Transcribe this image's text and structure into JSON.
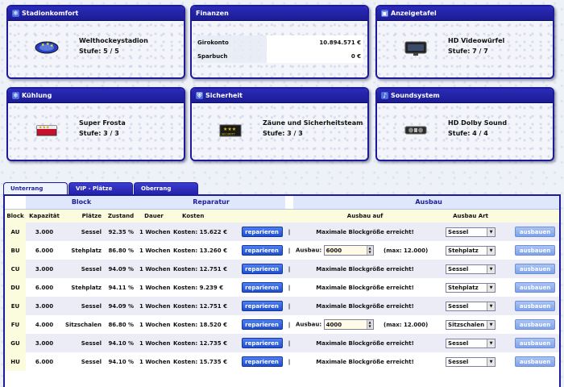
{
  "panels": {
    "stadionkomfort": {
      "title": "Stadionkomfort",
      "name": "Welthockeystadion",
      "level": "Stufe: 5 / 5"
    },
    "finanzen": {
      "title": "Finanzen",
      "rows": [
        {
          "label": "Girokonto",
          "value": "10.894.571 €"
        },
        {
          "label": "Sparbuch",
          "value": "0 €"
        }
      ]
    },
    "anzeigetafel": {
      "title": "Anzeigetafel",
      "name": "HD Videowürfel",
      "level": "Stufe: 7 / 7"
    },
    "kuehlung": {
      "title": "Kühlung",
      "name": "Super Frosta",
      "level": "Stufe: 3 / 3"
    },
    "sicherheit": {
      "title": "Sicherheit",
      "name": "Zäune und Sicherheitsteam",
      "level": "Stufe: 3 / 3",
      "badge": "SECURITY"
    },
    "soundsystem": {
      "title": "Soundsystem",
      "name": "HD Dolby Sound",
      "level": "Stufe: 4 / 4"
    }
  },
  "tabs": [
    {
      "label": "Unterrang",
      "active": true
    },
    {
      "label": "VIP - Plätze",
      "active": false
    },
    {
      "label": "Oberrang",
      "active": false
    }
  ],
  "table": {
    "groups": {
      "block": "Block",
      "reparatur": "Reparatur",
      "ausbau": "Ausbau"
    },
    "columns": {
      "block": "Block",
      "kapazitaet": "Kapazität",
      "plaetze": "Plätze",
      "zustand": "Zustand",
      "dauer": "Dauer",
      "kosten": "Kosten",
      "ausbau_auf": "Ausbau auf",
      "ausbau_art": "Ausbau Art"
    },
    "repair_label": "reparieren",
    "build_label": "ausbauen",
    "separator": "|",
    "rows": [
      {
        "block": "AU",
        "kapazitaet": "3.000",
        "plaetze": "Sessel",
        "zustand": "92.35 %",
        "dauer": "1 Wochen",
        "kosten": "Kosten: 15.622 €",
        "ausbau_text": "Maximale Blockgröße erreicht!",
        "art": "Sessel"
      },
      {
        "block": "BU",
        "kapazitaet": "6.000",
        "plaetze": "Stehplatz",
        "zustand": "86.80 %",
        "dauer": "1 Wochen",
        "kosten": "Kosten: 13.260 €",
        "ausbau_label": "Ausbau:",
        "ausbau_value": "6000",
        "ausbau_max": "(max: 12.000)",
        "art": "Stehplatz"
      },
      {
        "block": "CU",
        "kapazitaet": "3.000",
        "plaetze": "Sessel",
        "zustand": "94.09 %",
        "dauer": "1 Wochen",
        "kosten": "Kosten: 12.751 €",
        "ausbau_text": "Maximale Blockgröße erreicht!",
        "art": "Sessel"
      },
      {
        "block": "DU",
        "kapazitaet": "6.000",
        "plaetze": "Stehplatz",
        "zustand": "94.11 %",
        "dauer": "1 Wochen",
        "kosten": "Kosten: 9.239 €",
        "ausbau_text": "Maximale Blockgröße erreicht!",
        "art": "Stehplatz"
      },
      {
        "block": "EU",
        "kapazitaet": "3.000",
        "plaetze": "Sessel",
        "zustand": "94.09 %",
        "dauer": "1 Wochen",
        "kosten": "Kosten: 12.751 €",
        "ausbau_text": "Maximale Blockgröße erreicht!",
        "art": "Sessel"
      },
      {
        "block": "FU",
        "kapazitaet": "4.000",
        "plaetze": "Sitzschalen",
        "zustand": "86.80 %",
        "dauer": "1 Wochen",
        "kosten": "Kosten: 18.520 €",
        "ausbau_label": "Ausbau:",
        "ausbau_value": "4000",
        "ausbau_max": "(max: 12.000)",
        "art": "Sitzschalen"
      },
      {
        "block": "GU",
        "kapazitaet": "3.000",
        "plaetze": "Sessel",
        "zustand": "94.10 %",
        "dauer": "1 Wochen",
        "kosten": "Kosten: 12.735 €",
        "ausbau_text": "Maximale Blockgröße erreicht!",
        "art": "Sessel"
      },
      {
        "block": "HU",
        "kapazitaet": "6.000",
        "plaetze": "Sessel",
        "zustand": "94.10 %",
        "dauer": "1 Wochen",
        "kosten": "Kosten: 15.735 €",
        "ausbau_text": "Maximale Blockgröße erreicht!",
        "art": "Sessel"
      }
    ]
  }
}
